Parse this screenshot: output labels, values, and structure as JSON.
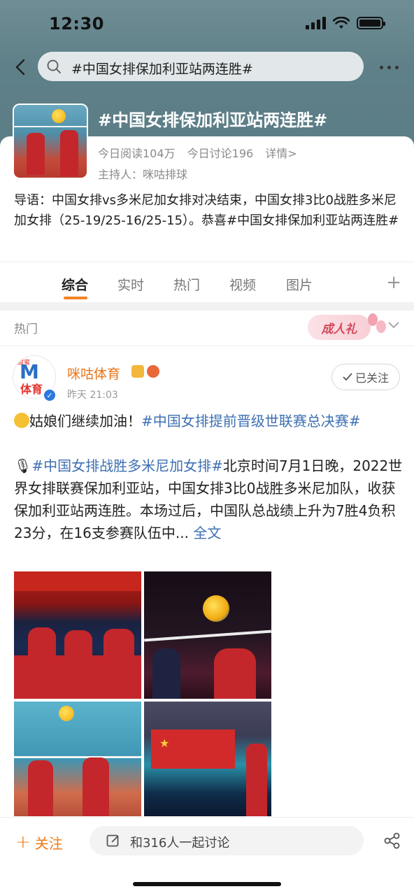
{
  "status_bar": {
    "time": "12:30"
  },
  "search": {
    "query": "#中国女排保加利亚站两连胜#"
  },
  "topic": {
    "title": "#中国女排保加利亚站两连胜#",
    "reads": "今日阅读104万",
    "discussions": "今日讨论196",
    "details": "详情>",
    "host": "主持人：咪咕排球",
    "intro": "导语：中国女排vs多米尼加女排对决结束，中国女排3比0战胜多米尼加女排（25-19/25-16/25-15）。恭喜#中国女排保加利亚站两连胜#"
  },
  "tabs": [
    {
      "label": "综合",
      "active": true
    },
    {
      "label": "实时",
      "active": false
    },
    {
      "label": "热门",
      "active": false
    },
    {
      "label": "视频",
      "active": false
    },
    {
      "label": "图片",
      "active": false
    }
  ],
  "hot_section": {
    "label": "热门",
    "badge": "成人礼"
  },
  "post": {
    "author": "咪咕体育",
    "avatar_text_top": "甜蜜",
    "avatar_text_bottom": "体育",
    "time": "昨天 21:03",
    "follow_label": "已关注",
    "line1_text": "姑娘们继续加油！",
    "line1_tag": "#中国女排提前晋级世联赛总决赛#",
    "para_tag": "#中国女排战胜多米尼加女排#",
    "para_text": "北京时间7月1日晚，2022世界女排联赛保加利亚站，中国女排3比0战胜多米尼加队，收获保加利亚站两连胜。本场过后，中国队总战绩上升为7胜4负积23分，在16支参赛队伍中...",
    "full_text_link": "全文"
  },
  "bottom_bar": {
    "follow_label": "关注",
    "comment_placeholder": "和316人一起讨论"
  },
  "colors": {
    "accent_orange": "#f28424",
    "link_blue": "#3d6fb2",
    "verified_blue": "#2b79dd"
  }
}
